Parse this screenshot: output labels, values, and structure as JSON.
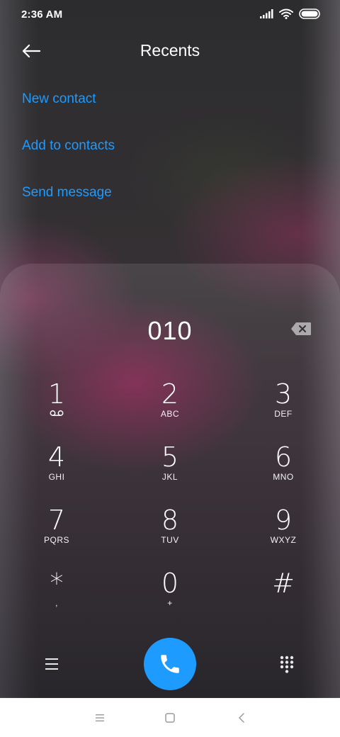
{
  "status_bar": {
    "time": "2:36 AM",
    "icons": [
      "signal-icon",
      "wifi-icon",
      "battery-icon"
    ]
  },
  "header": {
    "title": "Recents",
    "back_icon": "back-arrow-icon"
  },
  "actions": {
    "new_contact": "New contact",
    "add_to_contacts": "Add to contacts",
    "send_message": "Send message"
  },
  "dialpad": {
    "number": "010",
    "keys": [
      {
        "digit": "1",
        "sub": ""
      },
      {
        "digit": "2",
        "sub": "ABC"
      },
      {
        "digit": "3",
        "sub": "DEF"
      },
      {
        "digit": "4",
        "sub": "GHI"
      },
      {
        "digit": "5",
        "sub": "JKL"
      },
      {
        "digit": "6",
        "sub": "MNO"
      },
      {
        "digit": "7",
        "sub": "PQRS"
      },
      {
        "digit": "8",
        "sub": "TUV"
      },
      {
        "digit": "9",
        "sub": "WXYZ"
      },
      {
        "digit": "*",
        "sub": ","
      },
      {
        "digit": "0",
        "sub": "+"
      },
      {
        "digit": "#",
        "sub": ""
      }
    ]
  },
  "colors": {
    "accent": "#1e9bff",
    "text": "#ffffff",
    "nav_background": "#ffffff"
  }
}
